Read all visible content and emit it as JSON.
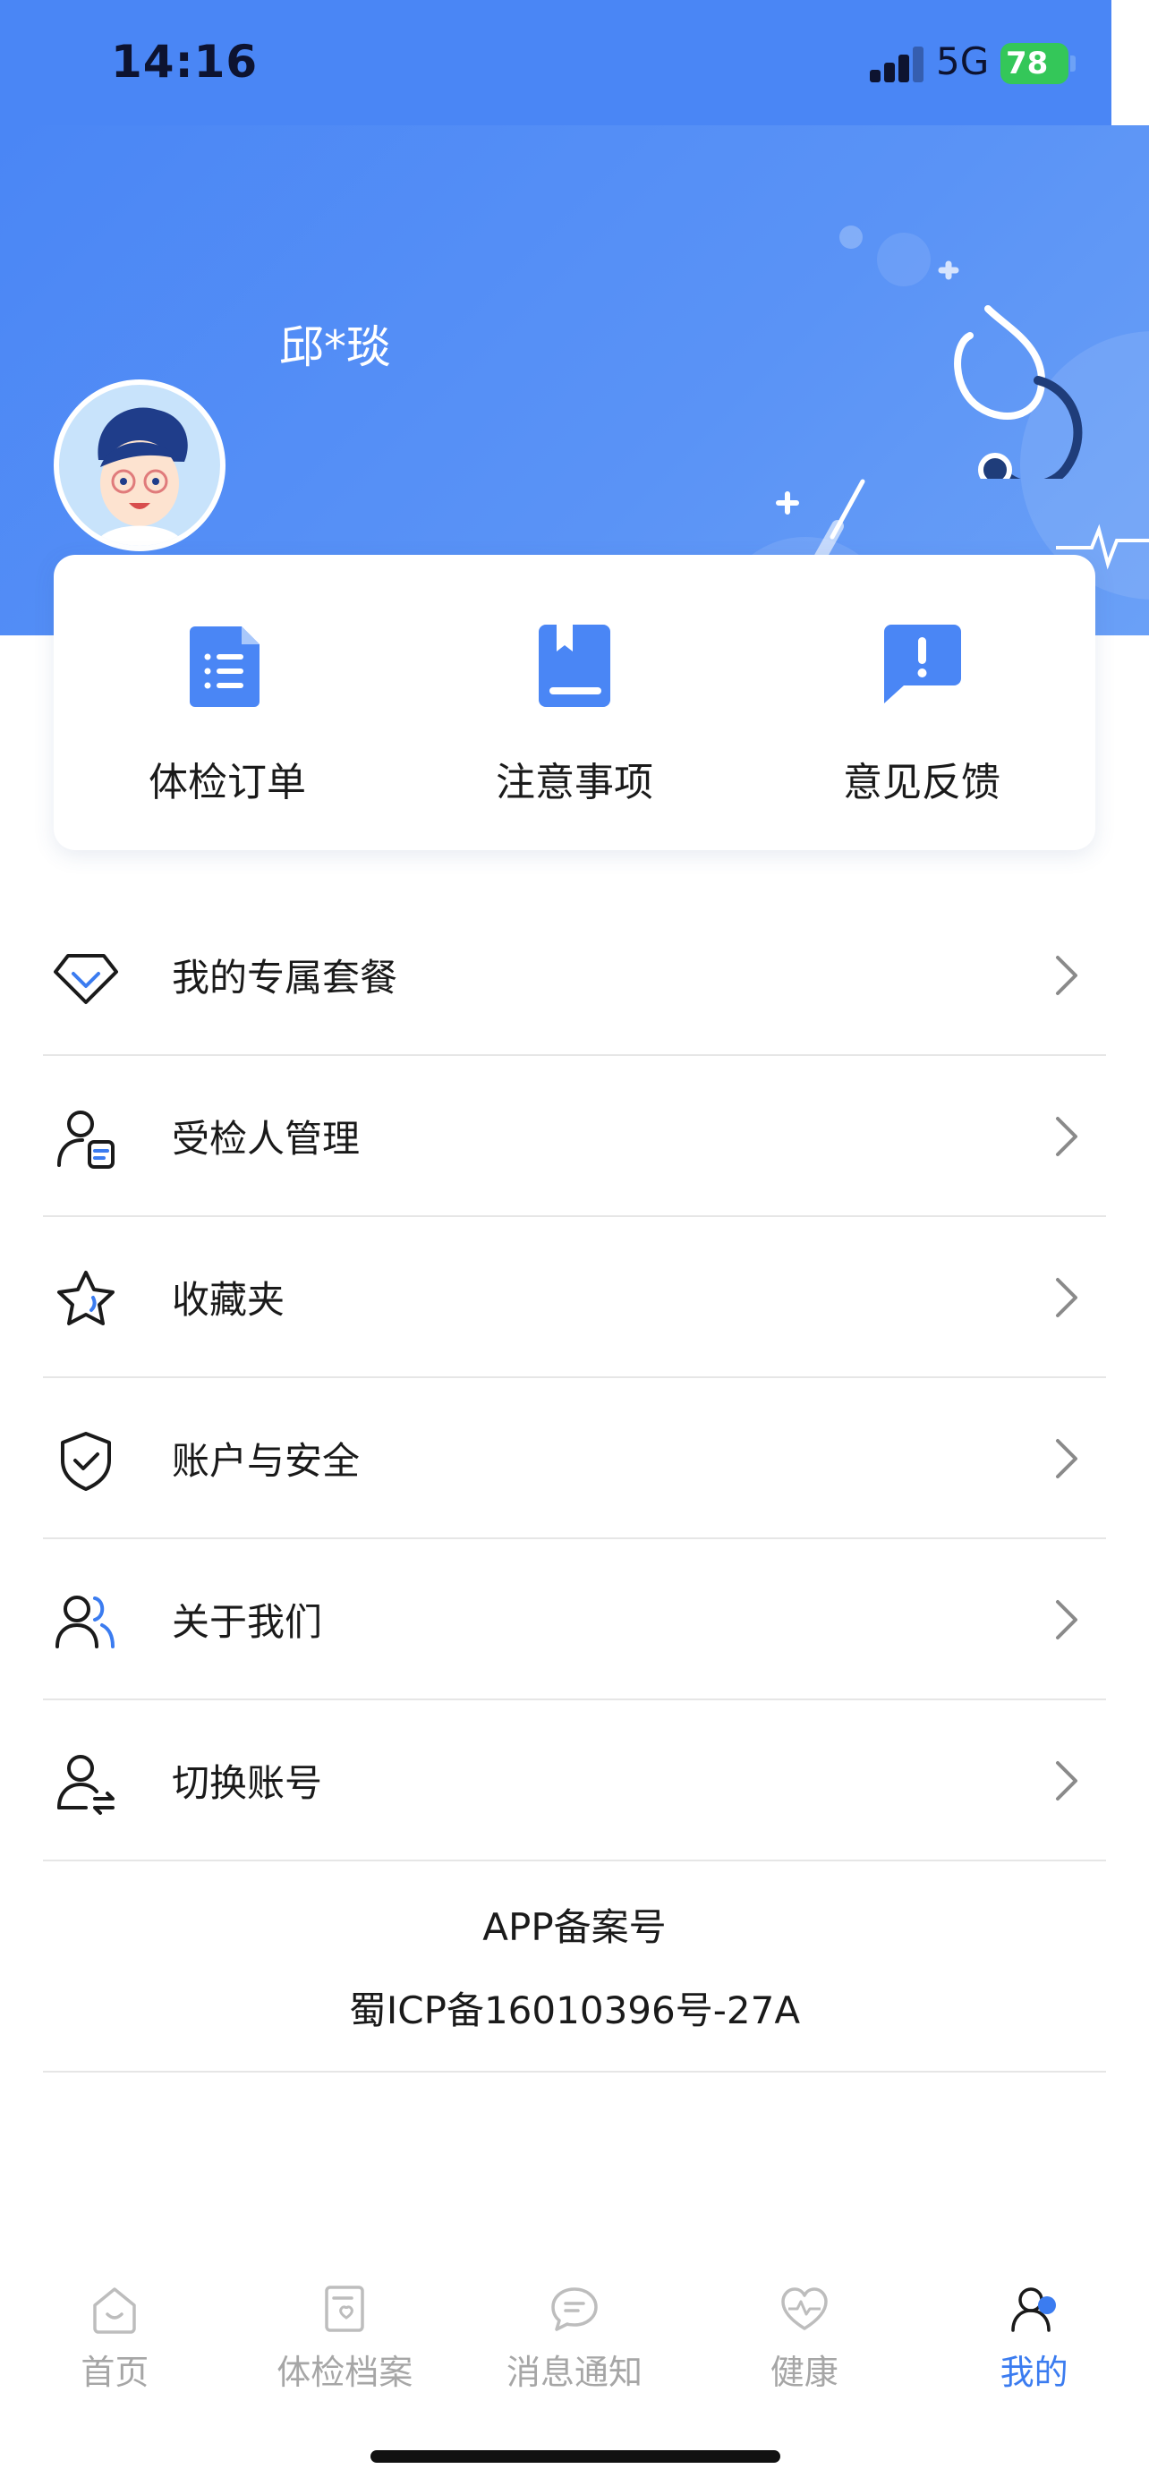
{
  "status": {
    "time": "14:16",
    "network": "5G",
    "battery": "78"
  },
  "profile": {
    "username": "邱*琰"
  },
  "quick_actions": [
    {
      "label": "体检订单",
      "icon": "order-list-icon"
    },
    {
      "label": "注意事项",
      "icon": "notebook-icon"
    },
    {
      "label": "意见反馈",
      "icon": "feedback-icon"
    }
  ],
  "menu": [
    {
      "label": "我的专属套餐",
      "icon": "diamond-icon"
    },
    {
      "label": "受检人管理",
      "icon": "person-card-icon"
    },
    {
      "label": "收藏夹",
      "icon": "star-icon"
    },
    {
      "label": "账户与安全",
      "icon": "shield-check-icon"
    },
    {
      "label": "关于我们",
      "icon": "people-icon"
    },
    {
      "label": "切换账号",
      "icon": "switch-account-icon"
    }
  ],
  "filing": {
    "title": "APP备案号",
    "number": "蜀ICP备16010396号-27A"
  },
  "tabs": [
    {
      "label": "首页",
      "icon": "home-icon",
      "active": false
    },
    {
      "label": "体检档案",
      "icon": "health-record-icon",
      "active": false
    },
    {
      "label": "消息通知",
      "icon": "message-icon",
      "active": false
    },
    {
      "label": "健康",
      "icon": "heart-pulse-icon",
      "active": false
    },
    {
      "label": "我的",
      "icon": "profile-icon",
      "active": true
    }
  ],
  "colors": {
    "brand": "#4a86f5",
    "active_tab": "#3b7cf0",
    "inactive_tab": "#a6a6a6"
  }
}
